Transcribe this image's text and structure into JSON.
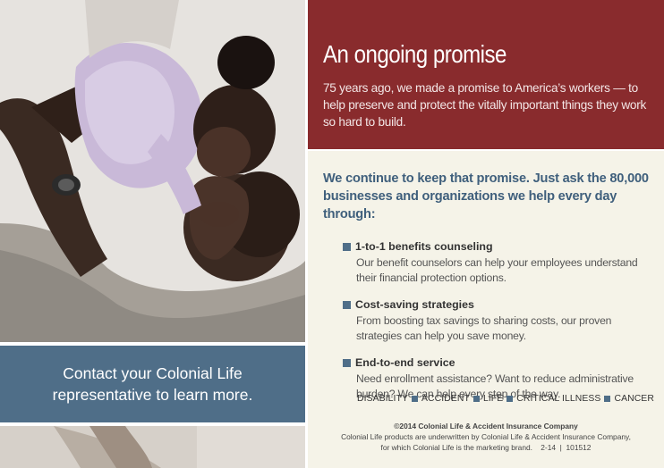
{
  "header": {
    "title": "An ongoing promise",
    "body": "75 years ago, we made a promise to America’s workers — to help preserve and protect the vitally important things they work so hard to build."
  },
  "main": {
    "lead": "We continue to keep that promise. Just ask the 80,000 businesses and organizations we help every day through:",
    "features": [
      {
        "title": "1-to-1 benefits counseling",
        "description": "Our benefit counselors can help your employees understand their financial protection options."
      },
      {
        "title": "Cost-saving strategies",
        "description": "From boosting tax savings to sharing costs, our proven strategies can help you save money."
      },
      {
        "title": "End-to-end service",
        "description": "Need enrollment assistance? Want to reduce administrative burden? We can help every step of the way."
      }
    ],
    "product_lines": [
      "DISABILITY",
      "ACCIDENT",
      "LIFE",
      "CRITICAL ILLNESS",
      "CANCER"
    ]
  },
  "contact": {
    "text": "Contact your Colonial Life representative to learn more."
  },
  "footer": {
    "copyright": "©2014 Colonial Life & Accident Insurance Company",
    "disclaimer_line1": "Colonial Life products are underwritten by Colonial Life & Accident Insurance Company,",
    "disclaimer_line2": "for which Colonial Life is the marketing brand.    2-14  |  101512"
  },
  "colors": {
    "header_bg": "#892b2d",
    "contact_bg": "#4f6e88",
    "content_bg": "#f5f3e8",
    "lead_text": "#3f5f7c",
    "bullet": "#4f6e88"
  },
  "images": {
    "main_photo": "father-lifting-child-photo",
    "bottom_photo": "cropped-photo-strip"
  }
}
